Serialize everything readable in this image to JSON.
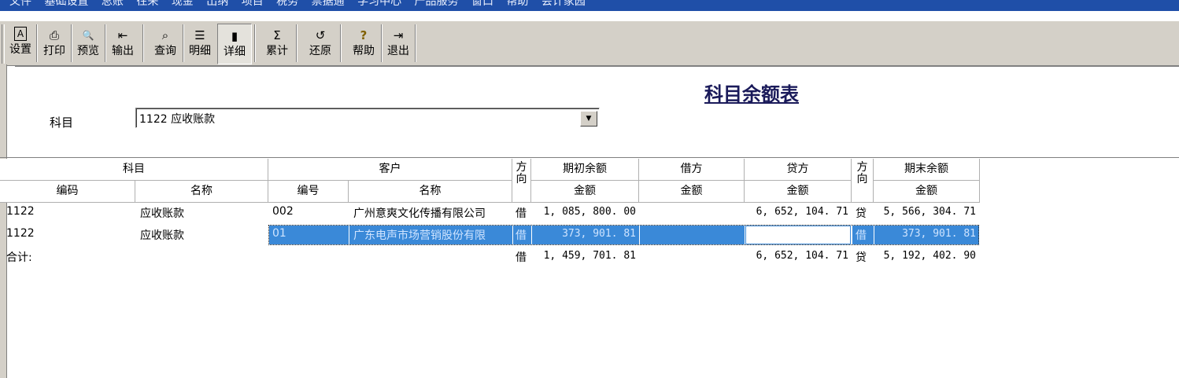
{
  "menu": [
    "文件",
    "基础设置",
    "总账",
    "往来",
    "现金",
    "出纳",
    "项目",
    "税务",
    "票据通",
    "学习中心",
    "产品服务",
    "窗口",
    "帮助",
    "会计家园"
  ],
  "toolbar": [
    {
      "icon": "A",
      "label": "设置"
    },
    {
      "icon": "⎙",
      "label": "打印"
    },
    {
      "icon": "🔍",
      "label": "预览"
    },
    {
      "icon": "⇤",
      "label": "输出"
    },
    {
      "icon": "⌕",
      "label": "查询"
    },
    {
      "icon": "☰",
      "label": "明细"
    },
    {
      "icon": "▮",
      "label": "详细"
    },
    {
      "icon": "Σ",
      "label": "累计"
    },
    {
      "icon": "↺",
      "label": "还原"
    },
    {
      "icon": "?",
      "label": "帮助"
    },
    {
      "icon": "⇥",
      "label": "退出"
    }
  ],
  "report": {
    "title": "科目余额表",
    "subject_label": "科目",
    "subject_value": "1122 应收账款"
  },
  "columns": {
    "subject": "科目",
    "code": "编码",
    "name": "名称",
    "customer": "客户",
    "cust_no": "编号",
    "cust_name": "名称",
    "direction": "方向",
    "opening": "期初余额",
    "debit": "借方",
    "credit": "贷方",
    "closing": "期末余额",
    "amount": "金额"
  },
  "rows": [
    {
      "code": "1122",
      "name": "应收账款",
      "cust_no": "002",
      "cust_name": "广州意爽文化传播有限公司",
      "dir1": "借",
      "opening": "1, 085, 800. 00",
      "debit": "",
      "credit": "6, 652, 104. 71",
      "dir2": "贷",
      "closing": "5, 566, 304. 71"
    },
    {
      "code": "1122",
      "name": "应收账款",
      "cust_no": "01",
      "cust_name": "广东电声市场营销股份有限",
      "dir1": "借",
      "opening": "373, 901. 81",
      "debit": "",
      "credit": "",
      "dir2": "借",
      "closing": "373, 901. 81"
    }
  ],
  "total": {
    "label": "合计:",
    "dir1": "借",
    "opening": "1, 459, 701. 81",
    "credit": "6, 652, 104. 71",
    "dir2": "贷",
    "closing": "5, 192, 402. 90"
  }
}
